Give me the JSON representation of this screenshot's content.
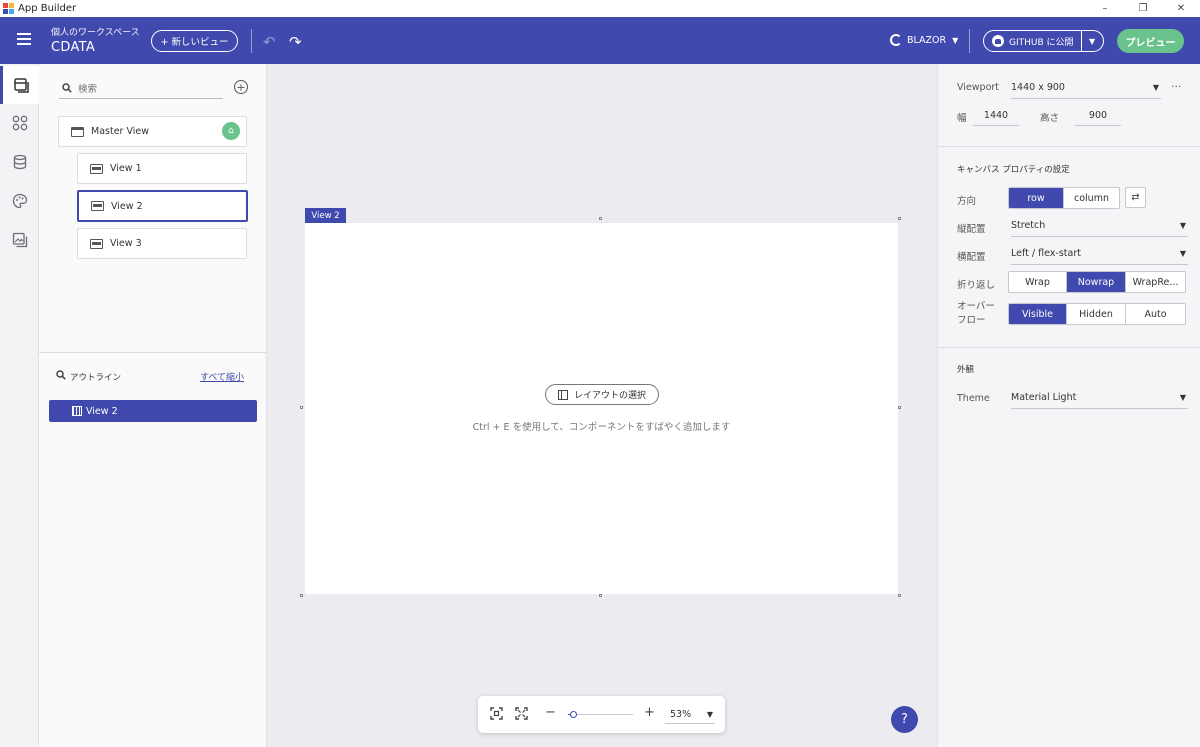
{
  "window": {
    "title": "App Builder",
    "controls": [
      "–",
      "❐",
      "✕"
    ]
  },
  "header": {
    "workspace_label": "個人のワークスペース",
    "project_name": "CDATA",
    "new_view_label": "+ 新しいビュー",
    "framework_label": "BLAZOR",
    "github_label": "GITHUB に公開",
    "preview_label": "プレビュー"
  },
  "left_rail": {
    "items": [
      "views-icon",
      "components-icon",
      "data-icon",
      "theme-icon",
      "assets-icon"
    ]
  },
  "views_panel": {
    "search_placeholder": "検索",
    "views": [
      {
        "label": "Master View",
        "type": "master"
      },
      {
        "label": "View 1",
        "type": "view"
      },
      {
        "label": "View 2",
        "type": "view",
        "selected": true
      },
      {
        "label": "View 3",
        "type": "view"
      }
    ]
  },
  "outline": {
    "title": "アウトライン",
    "collapse_all": "すべて縮小",
    "items": [
      "View 2"
    ]
  },
  "canvas": {
    "view_tag": "View 2",
    "layout_select_label": "レイアウトの選択",
    "hint": "Ctrl + E を使用して、コンポーネントをすばやく追加します"
  },
  "zoom": {
    "value_label": "53%",
    "level": 0.08
  },
  "help": "?",
  "properties": {
    "viewport_label": "Viewport",
    "viewport_value": "1440 x 900",
    "width_label": "幅",
    "width_value": "1440",
    "height_label": "高さ",
    "height_value": "900",
    "canvas_section_title": "キャンバス プロパティの設定",
    "direction_label": "方向",
    "direction_options": [
      "row",
      "column"
    ],
    "direction_selected": "row",
    "vertical_align_label": "縦配置",
    "vertical_align_value": "Stretch",
    "horizontal_align_label": "横配置",
    "horizontal_align_value": "Left / flex-start",
    "wrap_label": "折り返し",
    "wrap_options": [
      "Wrap",
      "Nowrap",
      "WrapRe..."
    ],
    "wrap_selected": "Nowrap",
    "overflow_label": "オーバーフロー",
    "overflow_options": [
      "Visible",
      "Hidden",
      "Auto"
    ],
    "overflow_selected": "Visible",
    "appearance_section_title": "外観",
    "theme_label": "Theme",
    "theme_value": "Material Light"
  },
  "colors": {
    "primary": "#4049ae",
    "accent_green": "#6ac28c"
  }
}
